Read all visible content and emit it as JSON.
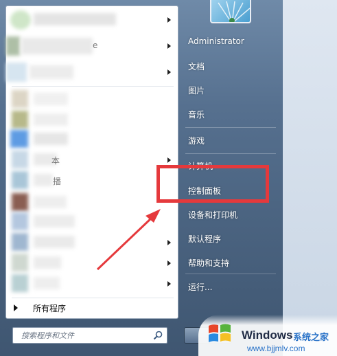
{
  "left_pane": {
    "item_labels": [
      "",
      "",
      "e",
      "",
      "",
      "",
      "",
      "本",
      "播",
      "",
      "",
      "",
      "",
      ""
    ],
    "all_programs_label": "所有程序"
  },
  "search": {
    "placeholder": "搜索程序和文件"
  },
  "right_pane": {
    "items": [
      {
        "label": "Administrator"
      },
      {
        "label": "文档"
      },
      {
        "label": "图片"
      },
      {
        "label": "音乐"
      },
      {
        "label": "游戏"
      },
      {
        "label": "计算机"
      },
      {
        "label": "控制面板"
      },
      {
        "label": "设备和打印机"
      },
      {
        "label": "默认程序"
      },
      {
        "label": "帮助和支持"
      },
      {
        "label": "运行..."
      }
    ]
  },
  "annotation": {
    "highlight_color": "#e5393c",
    "highlighted_item": "控制面板"
  },
  "watermark": {
    "brand": "Windows",
    "brand_cn": "系统之家",
    "url": "www.bjjmlv.com"
  }
}
